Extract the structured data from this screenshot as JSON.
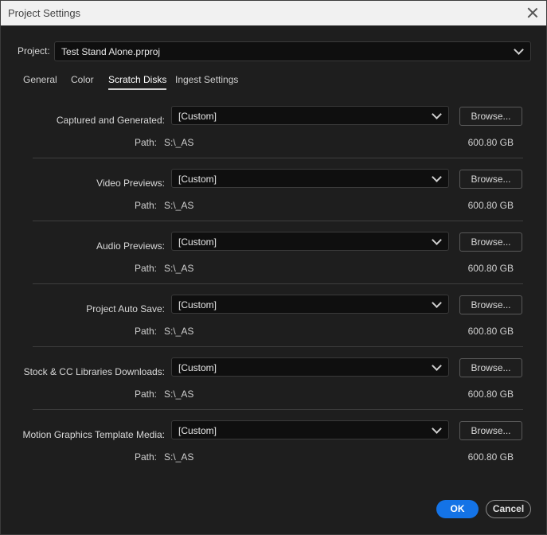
{
  "window": {
    "title": "Project Settings"
  },
  "project": {
    "label": "Project:",
    "value": "Test Stand Alone.prproj"
  },
  "tabs": [
    {
      "label": "General"
    },
    {
      "label": "Color"
    },
    {
      "label": "Scratch Disks",
      "active": true
    },
    {
      "label": "Ingest Settings"
    }
  ],
  "rows": [
    {
      "label": "Captured and Generated:",
      "value": "[Custom]",
      "browse": "Browse...",
      "path_label": "Path:",
      "path": "S:\\_AS",
      "space": "600.80 GB"
    },
    {
      "label": "Video Previews:",
      "value": "[Custom]",
      "browse": "Browse...",
      "path_label": "Path:",
      "path": "S:\\_AS",
      "space": "600.80 GB"
    },
    {
      "label": "Audio Previews:",
      "value": "[Custom]",
      "browse": "Browse...",
      "path_label": "Path:",
      "path": "S:\\_AS",
      "space": "600.80 GB"
    },
    {
      "label": "Project Auto Save:",
      "value": "[Custom]",
      "browse": "Browse...",
      "path_label": "Path:",
      "path": "S:\\_AS",
      "space": "600.80 GB"
    },
    {
      "label": "Stock & CC Libraries Downloads:",
      "value": "[Custom]",
      "browse": "Browse...",
      "path_label": "Path:",
      "path": "S:\\_AS",
      "space": "600.80 GB"
    },
    {
      "label": "Motion Graphics Template Media:",
      "value": "[Custom]",
      "browse": "Browse...",
      "path_label": "Path:",
      "path": "S:\\_AS",
      "space": "600.80 GB"
    }
  ],
  "footer": {
    "ok": "OK",
    "cancel": "Cancel"
  },
  "colors": {
    "accent": "#1473e6",
    "background": "#1e1e1e",
    "titlebar": "#f1f1f1"
  }
}
